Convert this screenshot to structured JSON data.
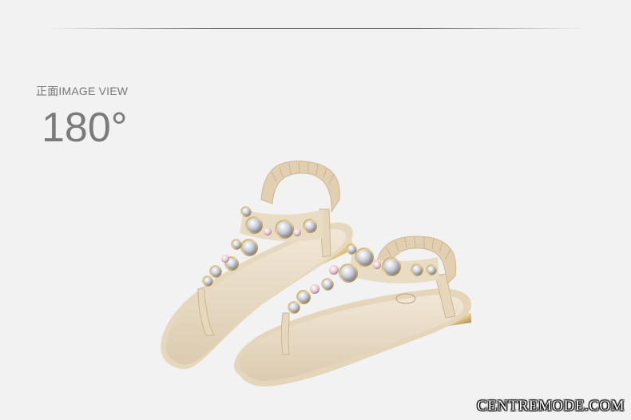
{
  "view_label": "正面IMAGE VIEW",
  "angle_label": "180°",
  "watermark": "CENTREMODE.COM",
  "product": {
    "name_icon": "jeweled-t-strap-sandals",
    "color": "#ece0cb"
  }
}
